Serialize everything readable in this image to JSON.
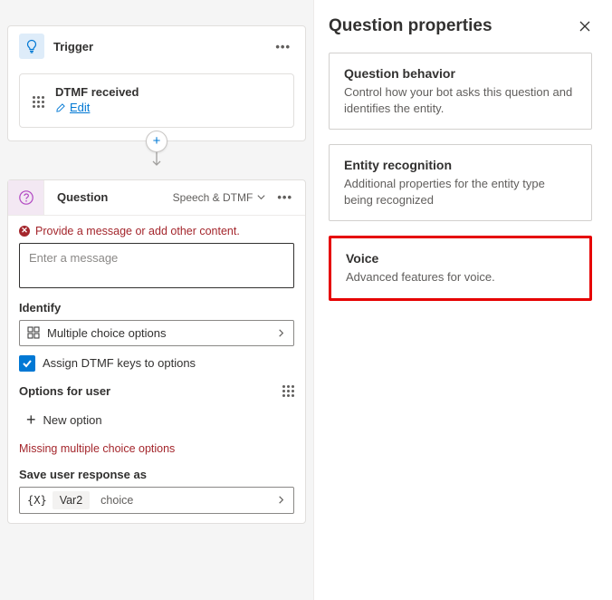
{
  "canvas": {
    "trigger": {
      "header_title": "Trigger",
      "inner_title": "DTMF received",
      "edit_link": "Edit"
    },
    "question": {
      "title": "Question",
      "mode_label": "Speech & DTMF",
      "error_message": "Provide a message or add other content.",
      "message_placeholder": "Enter a message",
      "identify_label": "Identify",
      "identify_value": "Multiple choice options",
      "assign_dtmf_label": "Assign DTMF keys to options",
      "assign_dtmf_checked": true,
      "options_label": "Options for user",
      "new_option_label": "New option",
      "options_error": "Missing multiple choice options",
      "save_label": "Save user response as",
      "var_name": "Var2",
      "var_type": "choice"
    }
  },
  "panel": {
    "title": "Question properties",
    "cards": [
      {
        "title": "Question behavior",
        "desc": "Control how your bot asks this question and identifies the entity."
      },
      {
        "title": "Entity recognition",
        "desc": "Additional properties for the entity type being recognized"
      },
      {
        "title": "Voice",
        "desc": "Advanced features for voice."
      }
    ]
  }
}
